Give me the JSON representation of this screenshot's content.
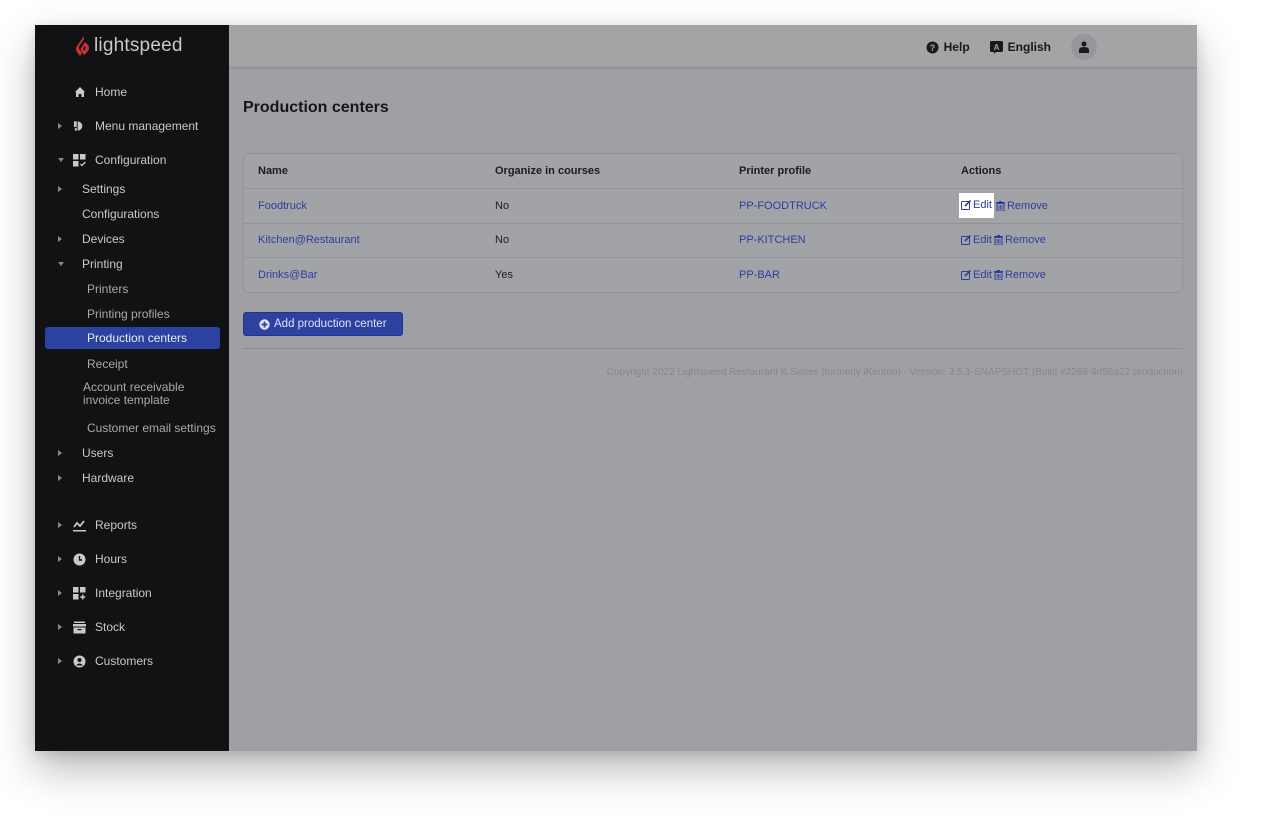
{
  "brand": {
    "name": "lightspeed",
    "accent": "#d0302f"
  },
  "topbar": {
    "help_label": "Help",
    "language_label": "English",
    "icons": [
      "question-circle-icon",
      "language-icon",
      "user-icon"
    ]
  },
  "sidebar": {
    "items": [
      {
        "label": "Home",
        "icon": "home-icon",
        "expandable": false
      },
      {
        "label": "Menu management",
        "icon": "menu-management-icon",
        "expandable": true,
        "expanded": false
      },
      {
        "label": "Configuration",
        "icon": "configuration-icon",
        "expandable": true,
        "expanded": true,
        "children": [
          {
            "label": "Settings",
            "expandable": true,
            "expanded": false
          },
          {
            "label": "Configurations",
            "expandable": false
          },
          {
            "label": "Devices",
            "expandable": true,
            "expanded": false
          },
          {
            "label": "Printing",
            "expandable": true,
            "expanded": true,
            "children": [
              {
                "label": "Printers"
              },
              {
                "label": "Printing profiles"
              },
              {
                "label": "Production centers",
                "active": true
              },
              {
                "label": "Receipt"
              },
              {
                "label": "Account receivable invoice template",
                "line1": "Account receivable",
                "line2": "invoice template"
              },
              {
                "label": "Customer email settings"
              }
            ]
          },
          {
            "label": "Users",
            "expandable": true,
            "expanded": false
          },
          {
            "label": "Hardware",
            "expandable": true,
            "expanded": false
          }
        ]
      },
      {
        "label": "Reports",
        "icon": "reports-icon",
        "expandable": true,
        "expanded": false
      },
      {
        "label": "Hours",
        "icon": "clock-icon",
        "expandable": true,
        "expanded": false
      },
      {
        "label": "Integration",
        "icon": "integration-icon",
        "expandable": true,
        "expanded": false
      },
      {
        "label": "Stock",
        "icon": "stock-icon",
        "expandable": true,
        "expanded": false
      },
      {
        "label": "Customers",
        "icon": "customers-icon",
        "expandable": true,
        "expanded": false
      }
    ]
  },
  "main": {
    "title": "Production centers",
    "table": {
      "columns": [
        "Name",
        "Organize in courses",
        "Printer profile",
        "Actions"
      ],
      "rows": [
        {
          "name": "Foodtruck",
          "organize_in_courses": "No",
          "printer_profile": "PP-FOODTRUCK",
          "edit": "Edit",
          "remove": "Remove"
        },
        {
          "name": "Kitchen@Restaurant",
          "organize_in_courses": "No",
          "printer_profile": "PP-KITCHEN",
          "edit": "Edit",
          "remove": "Remove"
        },
        {
          "name": "Drinks@Bar",
          "organize_in_courses": "Yes",
          "printer_profile": "PP-BAR",
          "edit": "Edit",
          "remove": "Remove"
        }
      ]
    },
    "add_button_label": "Add production center",
    "footer": "Copyright 2022 Lightspeed Restaurant K Series (formerly iKentoo) - Version: 3.5.1-SNAPSHOT (Build #2268-9d58a22 production)"
  },
  "colors": {
    "primary": "#2c42a0",
    "link": "#2b3e9f",
    "sidebar_bg": "#111214",
    "highlight": "#ffffff"
  }
}
